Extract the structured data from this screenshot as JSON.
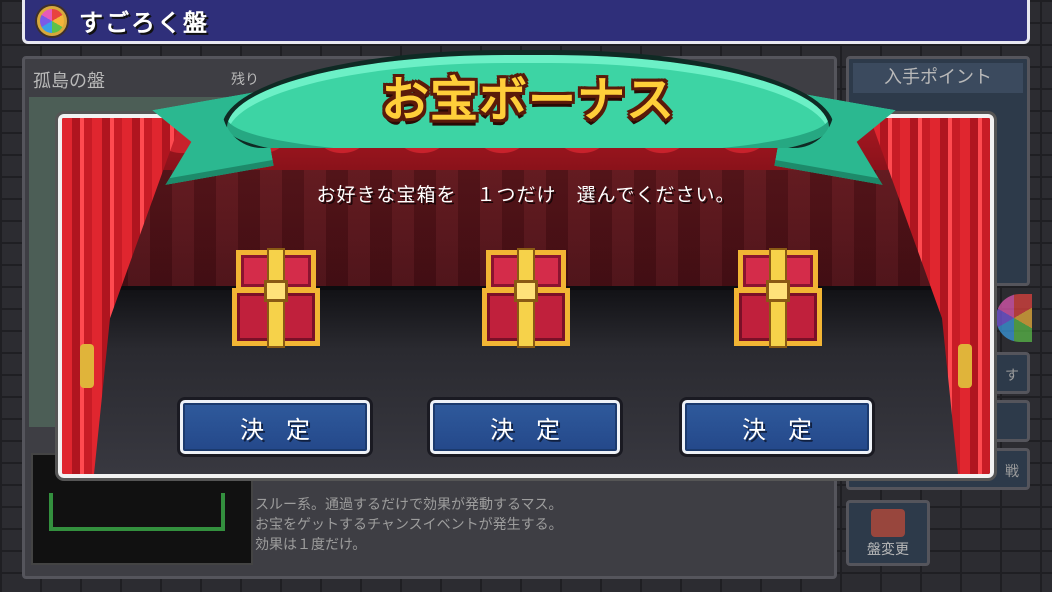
{
  "header": {
    "title": "すごろく盤",
    "icon": "roulette-wheel-icon"
  },
  "background": {
    "board_name": "孤島の盤",
    "remaining_label": "残り",
    "points_title": "入手ポイント",
    "side_button_1_partial": "す",
    "side_button_3_partial": "戦",
    "change_board_label": "盤変更",
    "description_lines": [
      "スルー系。通過するだけで効果が発動するマス。",
      "お宝をゲットするチャンスイベントが発生する。",
      "効果は１度だけ。"
    ]
  },
  "modal": {
    "title": "お宝ボーナス",
    "prompt": "お好きな宝箱を　１つだけ　選んでください。",
    "chests": [
      {
        "icon": "treasure-chest-icon",
        "button_label": "決定"
      },
      {
        "icon": "treasure-chest-icon",
        "button_label": "決定"
      },
      {
        "icon": "treasure-chest-icon",
        "button_label": "決定"
      }
    ]
  },
  "colors": {
    "title_bar": "#2f2f7a",
    "ribbon": "#3dd4a4",
    "banner_text": "#ffcf3a",
    "curtain": "#e0262f",
    "chest_red": "#c0203c",
    "chest_gold": "#f2b534",
    "decide_button": "#2f5a9c"
  }
}
